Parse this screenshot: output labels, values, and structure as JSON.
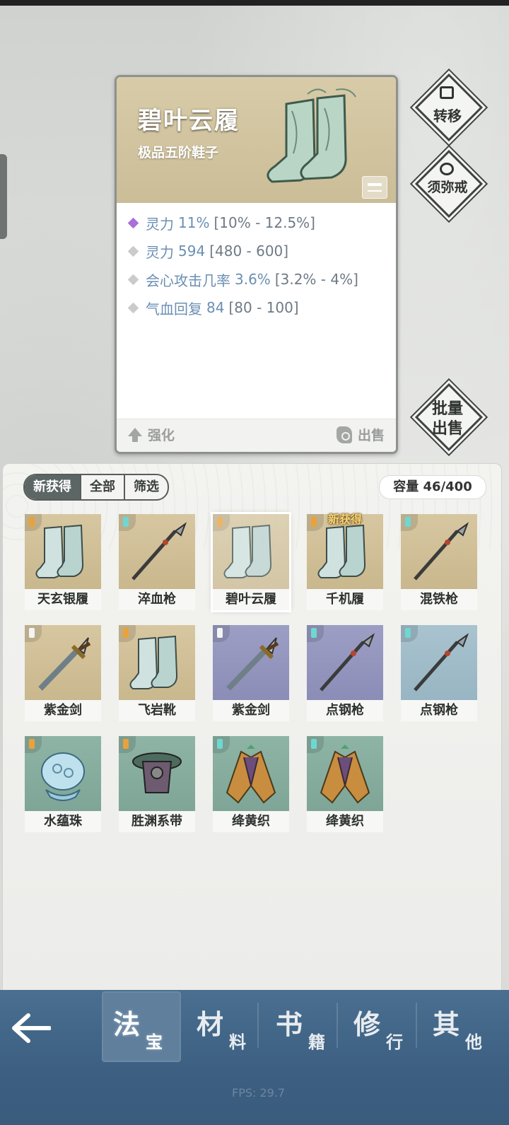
{
  "item_card": {
    "title": "碧叶云履",
    "subtitle": "极品五阶鞋子",
    "stats": [
      {
        "name": "灵力",
        "value": "11%",
        "range": "[10% - 12.5%]",
        "tier": "purple"
      },
      {
        "name": "灵力",
        "value": "594",
        "range": "[480 - 600]",
        "tier": "grey"
      },
      {
        "name": "会心攻击几率",
        "value": "3.6%",
        "range": "[3.2% - 4%]",
        "tier": "grey"
      },
      {
        "name": "气血回复",
        "value": "84",
        "range": "[80 - 100]",
        "tier": "grey"
      }
    ],
    "enhance_label": "强化",
    "sell_label": "出售"
  },
  "side_buttons": {
    "transfer": "转移",
    "ring": "须弥戒",
    "batch_line1": "批量",
    "batch_line2": "出售"
  },
  "inventory": {
    "tabs": [
      "新获得",
      "全部",
      "筛选"
    ],
    "capacity_label": "容量 46/400",
    "new_tag": "新获得",
    "items": [
      {
        "name": "天玄银履",
        "bg": "tan",
        "type": "boots"
      },
      {
        "name": "淬血枪",
        "bg": "tan",
        "type": "spear"
      },
      {
        "name": "碧叶云履",
        "bg": "tan",
        "type": "boots",
        "selected": true
      },
      {
        "name": "千机履",
        "bg": "tan",
        "type": "boots",
        "new": true
      },
      {
        "name": "混铁枪",
        "bg": "tan",
        "type": "spear"
      },
      {
        "name": "紫金剑",
        "bg": "tan",
        "type": "sword"
      },
      {
        "name": "飞岩靴",
        "bg": "tan",
        "type": "boots"
      },
      {
        "name": "紫金剑",
        "bg": "purp",
        "type": "sword"
      },
      {
        "name": "点钢枪",
        "bg": "purp",
        "type": "spear"
      },
      {
        "name": "点钢枪",
        "bg": "blue",
        "type": "spear"
      },
      {
        "name": "水蕴珠",
        "bg": "teal",
        "type": "orb"
      },
      {
        "name": "胜渊系带",
        "bg": "teal",
        "type": "belt"
      },
      {
        "name": "绛黄织",
        "bg": "teal",
        "type": "robe"
      },
      {
        "name": "绛黄织",
        "bg": "teal",
        "type": "robe"
      }
    ]
  },
  "nav": {
    "items": [
      {
        "big": "法",
        "small": "宝"
      },
      {
        "big": "材",
        "small": "料"
      },
      {
        "big": "书",
        "small": "籍"
      },
      {
        "big": "修",
        "small": "行"
      },
      {
        "big": "其",
        "small": "他"
      }
    ]
  },
  "fps": "FPS: 29.7",
  "colors": {
    "nav": "#3c5f82",
    "card_head": "#d8cba8",
    "purple_stat": "#a771d9"
  }
}
